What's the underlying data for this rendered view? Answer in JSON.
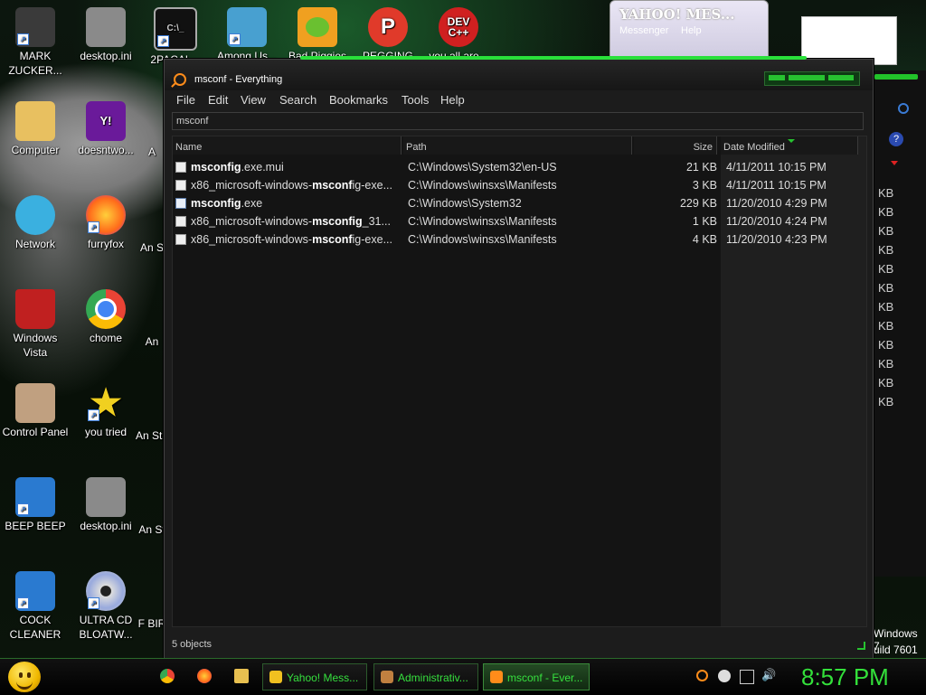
{
  "desktop_icons": [
    {
      "label": "MARK ZUCKER...",
      "icon": "mark-zuckerberg-icon",
      "color": "#444"
    },
    {
      "label": "desktop.ini",
      "icon": "settings-file-icon",
      "color": "#888"
    },
    {
      "label": "2PACAL...",
      "icon": "cmd-icon",
      "color": "#111"
    },
    {
      "label": "Among Us...",
      "icon": "among-us-icon",
      "color": "#48a0d0"
    },
    {
      "label": "Bad Piggies",
      "icon": "bad-piggies-icon",
      "color": "#f0a020"
    },
    {
      "label": "PEGGING",
      "icon": "p-icon",
      "color": "#e03a2a"
    },
    {
      "label": "you all are...",
      "icon": "dev-cpp-icon",
      "color": "#d02020"
    },
    {
      "label": "Computer",
      "icon": "computer-icon",
      "color": "#e8c060"
    },
    {
      "label": "doesntwo...",
      "icon": "yahoo-icon",
      "color": "#6a1a9a"
    },
    {
      "label": "Network",
      "icon": "network-icon",
      "color": "#3ab0e0"
    },
    {
      "label": "furryfox",
      "icon": "firefox-icon",
      "color": "#ff7a1a"
    },
    {
      "label": "Windows Vista",
      "icon": "recycle-bin-icon",
      "color": "#c02020"
    },
    {
      "label": "chome",
      "icon": "chrome-icon",
      "color": "#4285f4"
    },
    {
      "label": "Control Panel",
      "icon": "control-panel-icon",
      "color": "#c0a080"
    },
    {
      "label": "you tried",
      "icon": "star-icon",
      "color": "#f0d020"
    },
    {
      "label": "BEEP BEEP",
      "icon": "blue-file-icon",
      "color": "#2a7ad0"
    },
    {
      "label": "desktop.ini",
      "icon": "settings-file-icon",
      "color": "#888"
    },
    {
      "label": "COCK CLEANER",
      "icon": "blue-file-icon",
      "color": "#2a7ad0"
    },
    {
      "label": "ULTRA CD BLOATW...",
      "icon": "cd-icon",
      "color": "#bbb"
    }
  ],
  "partial_icons": [
    "A",
    "An S",
    "An",
    "An Sta",
    "An St",
    "F BIR"
  ],
  "yahoo_window": {
    "title": "YAHOO! MES...",
    "menu1": "Messenger",
    "menu2": "Help"
  },
  "window": {
    "title": "msconf - Everything",
    "menu": [
      "File",
      "Edit",
      "View",
      "Search",
      "Bookmarks",
      "Tools",
      "Help"
    ],
    "search_value": "msconf",
    "columns": [
      "Name",
      "Path",
      "Size",
      "Date Modified"
    ],
    "rows": [
      {
        "name_bold": "msconfig",
        "name_rest": ".exe.mui",
        "name_pre": "",
        "path": "C:\\Windows\\System32\\en-US",
        "size": "21 KB",
        "date": "4/11/2011 10:15 PM",
        "type": "file"
      },
      {
        "name_pre": "x86_microsoft-windows-",
        "name_bold": "msconf",
        "name_rest": "ig-exe...",
        "path": "C:\\Windows\\winsxs\\Manifests",
        "size": "3 KB",
        "date": "4/11/2011 10:15 PM",
        "type": "file"
      },
      {
        "name_pre": "",
        "name_bold": "msconfig",
        "name_rest": ".exe",
        "path": "C:\\Windows\\System32",
        "size": "229 KB",
        "date": "11/20/2010 4:29 PM",
        "type": "exe"
      },
      {
        "name_pre": "x86_microsoft-windows-",
        "name_bold": "msconfig",
        "name_rest": "_31...",
        "path": "C:\\Windows\\winsxs\\Manifests",
        "size": "1 KB",
        "date": "11/20/2010 4:24 PM",
        "type": "file"
      },
      {
        "name_pre": "x86_microsoft-windows-",
        "name_bold": "msconf",
        "name_rest": "ig-exe...",
        "path": "C:\\Windows\\winsxs\\Manifests",
        "size": "4 KB",
        "date": "11/20/2010 4:23 PM",
        "type": "file"
      }
    ],
    "status": "5 objects"
  },
  "right_window": {
    "kb": [
      "KB",
      "KB",
      "KB",
      "KB",
      "KB",
      "KB",
      "KB",
      "KB",
      "KB",
      "KB",
      "KB",
      "KB"
    ]
  },
  "windows_info": {
    "line1": "Windows 7",
    "line2": "uild 7601"
  },
  "taskbar": {
    "buttons": [
      {
        "label": "Yahoo! Mess...",
        "icon": "yahoo-smiley-icon",
        "color": "#f0c020",
        "active": false
      },
      {
        "label": "Administrativ...",
        "icon": "admin-tools-icon",
        "color": "#c08040",
        "active": false
      },
      {
        "label": "msconf - Ever...",
        "icon": "search-icon",
        "color": "#ff8c1a",
        "active": true
      }
    ],
    "clock": "8:57 PM"
  },
  "colors": {
    "accent": "#27c330",
    "clock": "#33e03a"
  }
}
